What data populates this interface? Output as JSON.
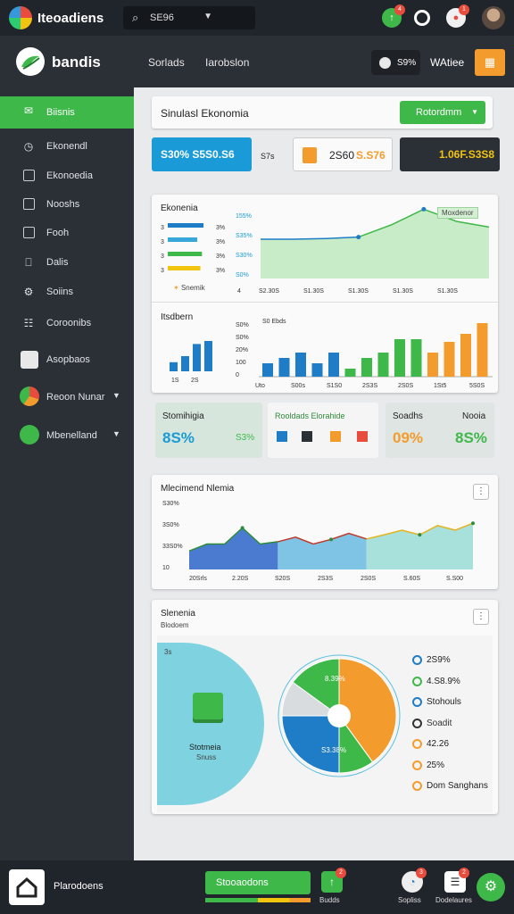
{
  "app": {
    "title": "Iteoadiens"
  },
  "search": {
    "value": "SE96"
  },
  "header": {
    "brand": "bandis",
    "nav": [
      "Sorlads",
      "Iarobslon"
    ],
    "pill_value": "S9%",
    "action": "WAtiee"
  },
  "sidebar": {
    "items": [
      {
        "label": "Biisnis"
      },
      {
        "label": "Ekonendl"
      },
      {
        "label": "Ekonoedia"
      },
      {
        "label": "Nooshs"
      },
      {
        "label": "Fooh"
      },
      {
        "label": "Dalis"
      },
      {
        "label": "Soiins"
      },
      {
        "label": "Coroonibs"
      },
      {
        "label": "Asopbaos"
      },
      {
        "label": "Reoon Nunar"
      },
      {
        "label": "Mbenelland"
      }
    ]
  },
  "sim": {
    "title": "Sinulasl Ekonomia",
    "button": "Rotordmm"
  },
  "stats": {
    "a": "S30% S5S0.S6",
    "b_label": "S7s",
    "b_v1": "2S60",
    "b_v2": "S.S76",
    "c": "1.06F.S3S8"
  },
  "panel1": {
    "title": "Ekonenia",
    "hbar_labels": [
      "3",
      "3",
      "3",
      "3"
    ],
    "hbar_vals": [
      "3%",
      "3%",
      "3%",
      "3%"
    ],
    "hbar_colors": [
      "#1f7dc7",
      "#36a7d8",
      "#3fb84a",
      "#f1c40f"
    ],
    "hbar_widths": [
      0.82,
      0.66,
      0.78,
      0.74
    ],
    "footer_label": "Snemik",
    "area_ylabels": [
      "155%",
      "S35%",
      "S30%",
      "S0%"
    ],
    "area_xlabels": [
      "4",
      "S2.30S",
      "S1.30S",
      "S1.30S",
      "S1.30S",
      "S1.30S"
    ],
    "area_tag": "Moxdenor",
    "area_values": [
      0.55,
      0.55,
      0.56,
      0.58,
      0.75,
      0.97,
      0.8,
      0.72
    ]
  },
  "panel2": {
    "title": "Itsdbern",
    "mini_bars": [
      0.3,
      0.5,
      0.9,
      1.0
    ],
    "mini_labels": [
      "1S",
      "2S"
    ],
    "legend": "S0 Ebds",
    "ylabels": [
      "S0%",
      "S0%",
      "20%",
      "100",
      "0"
    ],
    "xlabels": [
      "Uto",
      "S00s",
      "S1S0",
      "2S3S",
      "2S0S",
      "1St5",
      "5S0S"
    ],
    "bars": [
      {
        "v": 0.25,
        "c": "#1f7dc7"
      },
      {
        "v": 0.35,
        "c": "#1f7dc7"
      },
      {
        "v": 0.45,
        "c": "#1f7dc7"
      },
      {
        "v": 0.25,
        "c": "#1f7dc7"
      },
      {
        "v": 0.45,
        "c": "#1f7dc7"
      },
      {
        "v": 0.15,
        "c": "#3fb84a"
      },
      {
        "v": 0.35,
        "c": "#3fb84a"
      },
      {
        "v": 0.45,
        "c": "#3fb84a"
      },
      {
        "v": 0.7,
        "c": "#3fb84a"
      },
      {
        "v": 0.7,
        "c": "#3fb84a"
      },
      {
        "v": 0.45,
        "c": "#f39c2d"
      },
      {
        "v": 0.65,
        "c": "#f39c2d"
      },
      {
        "v": 0.8,
        "c": "#f39c2d"
      },
      {
        "v": 1.0,
        "c": "#f39c2d"
      }
    ]
  },
  "tiles": {
    "t1_label": "Stomihigia",
    "t1_val": "8S%",
    "t1_val2": "S3%",
    "t2_label": "Rooldads Elorahide",
    "t3_label": "Soadhs",
    "t3_label2": "Nooia",
    "t3_val": "09%",
    "t3_val2": "8S%"
  },
  "panel3": {
    "title": "Mlecimend Nlemia",
    "ylabels": [
      "S30%",
      "3S0%",
      "33S0%",
      "10"
    ],
    "xlabels": [
      "20Srls",
      "2.20S",
      "S20S",
      "2S3S",
      "2S0S",
      "S.60S",
      "S.S00"
    ],
    "line_values": [
      0.4,
      0.55,
      0.55,
      0.9,
      0.55,
      0.6,
      0.7,
      0.55,
      0.65,
      0.78,
      0.66,
      0.75,
      0.85,
      0.75,
      0.95,
      0.85,
      1.0
    ]
  },
  "panel4": {
    "title": "Slenenia",
    "subtitle": "Blodoem",
    "corner": "3s",
    "cube_label": "Stotmeia",
    "cube_sub": "Snuss",
    "pie_center_label": "S3.38%",
    "pie_top_label": "8.39%",
    "slices": [
      {
        "v": 0.4,
        "c": "#f39c2d"
      },
      {
        "v": 0.1,
        "c": "#3fb84a"
      },
      {
        "v": 0.25,
        "c": "#1f7dc7"
      },
      {
        "v": 0.1,
        "c": "#d9dcdf"
      },
      {
        "v": 0.15,
        "c": "#3fb84a"
      }
    ],
    "legend": [
      {
        "text": "2S9%",
        "c": "#1f7dc7"
      },
      {
        "text": "4.S8.9%",
        "c": "#3fb84a"
      },
      {
        "text": "Stohouls",
        "c": "#1f7dc7"
      },
      {
        "text": "Soadit",
        "c": "#333"
      },
      {
        "text": "42.26",
        "c": "#f39c2d"
      },
      {
        "text": "25%",
        "c": "#f39c2d"
      },
      {
        "text": "Dom Sanghans",
        "c": "#f39c2d"
      }
    ]
  },
  "footer": {
    "label": "Plarodoens",
    "button": "Stooaodons",
    "icons": [
      {
        "name": "Budds",
        "notif": "2"
      },
      {
        "name": "Sopliss",
        "notif": "3"
      },
      {
        "name": "Dodelaures",
        "notif": "2"
      }
    ]
  }
}
